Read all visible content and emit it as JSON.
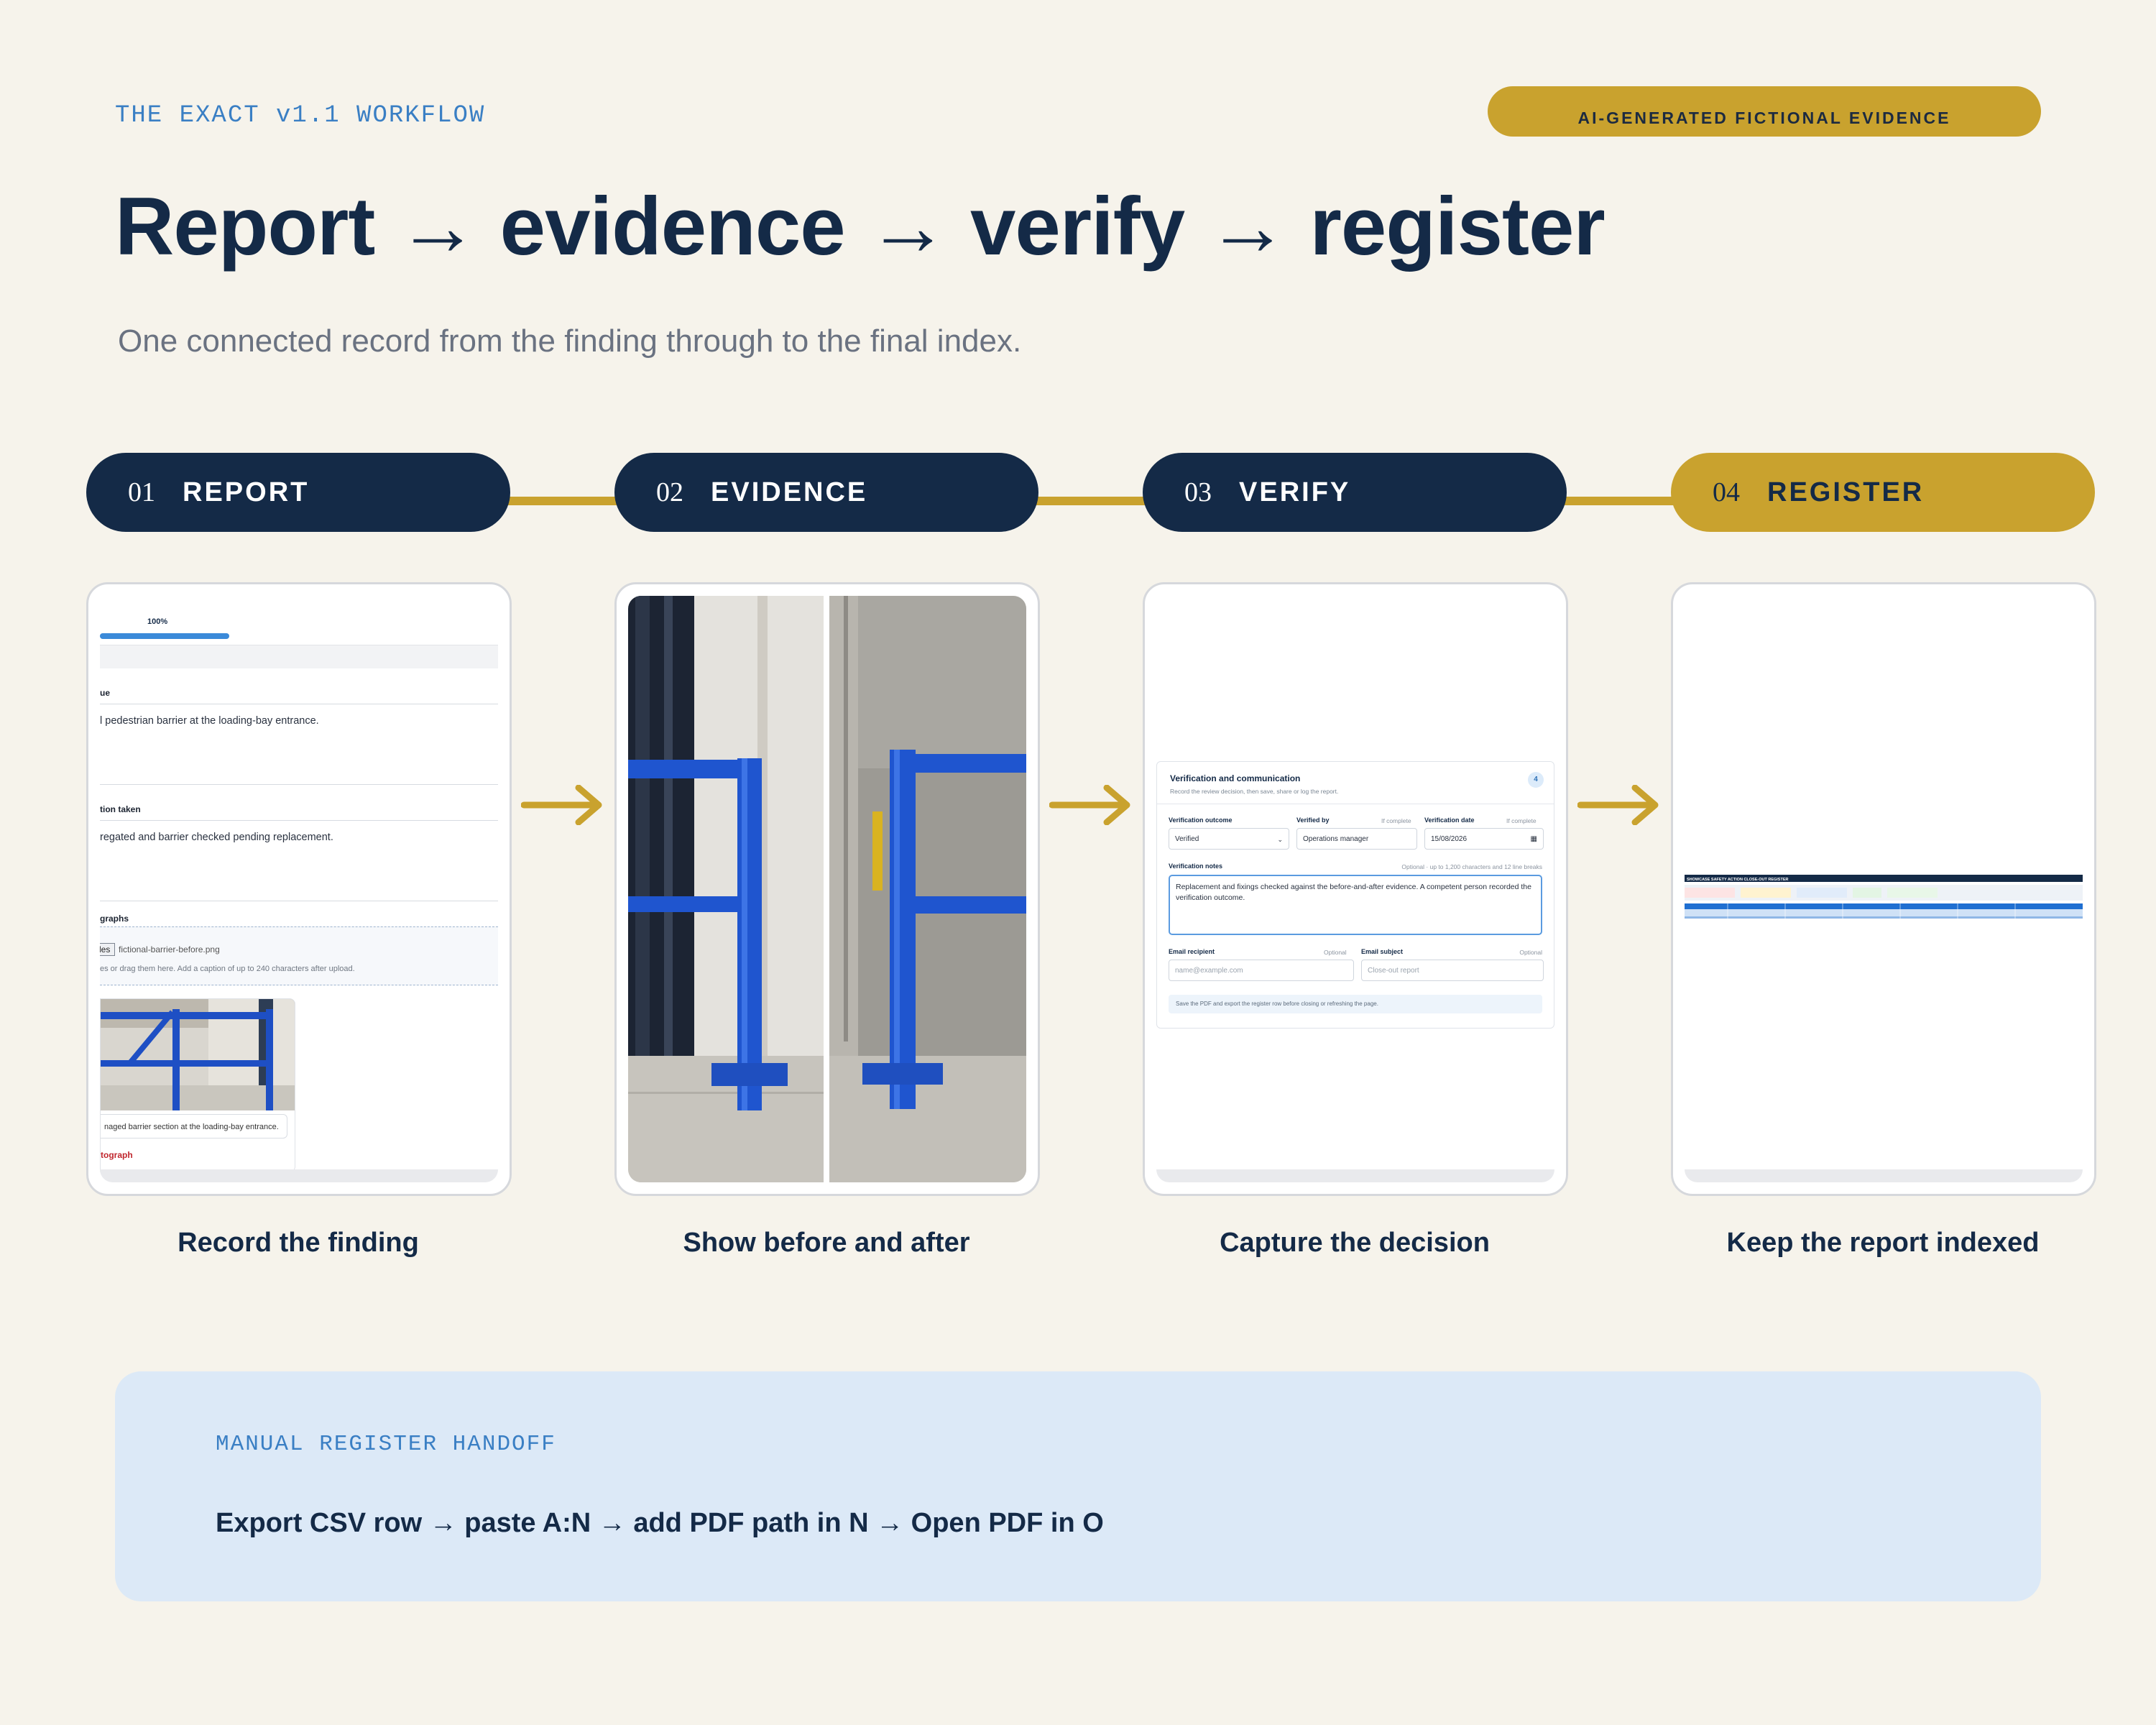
{
  "header": {
    "eyebrow": "THE EXACT v1.1 WORKFLOW",
    "badge": "AI-GENERATED FICTIONAL EVIDENCE",
    "title": "Report → evidence → verify → register",
    "subtitle": "One connected record from the finding through to the final index."
  },
  "colors": {
    "navy": "#142a47",
    "gold": "#c9a22e",
    "background": "#f6f3eb",
    "panel": "#dce9f7",
    "accent_blue": "#3a7fc4"
  },
  "steps": [
    {
      "num": "01",
      "label": "REPORT",
      "caption": "Record the finding"
    },
    {
      "num": "02",
      "label": "EVIDENCE",
      "caption": "Show before and after"
    },
    {
      "num": "03",
      "label": "VERIFY",
      "caption": "Capture the decision"
    },
    {
      "num": "04",
      "label": "REGISTER",
      "caption": "Keep the report indexed"
    }
  ],
  "arrows": [
    "arrow-right-icon",
    "arrow-right-icon",
    "arrow-right-icon"
  ],
  "report_screen": {
    "progress_value": 1.0,
    "progress_label": "100%",
    "issue_label": "ue",
    "issue_text": "l pedestrian barrier at the loading-bay entrance.",
    "action_label": "tion taken",
    "action_text": "regated and barrier checked pending replacement.",
    "photos_label": "graphs",
    "file_button": "les",
    "file_name": "fictional-barrier-before.png",
    "file_hint": "es or drag them here. Add a caption of up to 240 characters after upload.",
    "photo_caption": "naged barrier section at the loading-bay entrance.",
    "remove_link": "tograph"
  },
  "verify_screen": {
    "title": "Verification and communication",
    "subtitle": "Record the review decision, then save, share or log the report.",
    "section_num": "4",
    "outcome_label": "Verification outcome",
    "outcome_value": "Verified",
    "verified_by_label": "Verified by",
    "verified_by_hint": "If complete",
    "verified_by_value": "Operations manager",
    "date_label": "Verification date",
    "date_hint": "If complete",
    "date_value": "15/08/2026",
    "notes_label": "Verification notes",
    "notes_hint": "Optional · up to 1,200 characters and 12 line breaks",
    "notes_value": "Replacement and fixings checked against the before-and-after evidence. A competent person recorded the verification outcome.",
    "email_label": "Email recipient",
    "email_hint": "Optional",
    "email_placeholder": "name@example.com",
    "subject_label": "Email subject",
    "subject_hint": "Optional",
    "subject_placeholder": "Close-out report",
    "save_note": "Save the PDF and export the register row before closing or refreshing the page."
  },
  "register_screen": {
    "sheet_title": "SHOWCASE SAFETY ACTION CLOSE-OUT REGISTER"
  },
  "handoff": {
    "eyebrow": "MANUAL REGISTER HANDOFF",
    "text": "Export CSV row → paste A:N → add PDF path in N → Open PDF in O"
  }
}
